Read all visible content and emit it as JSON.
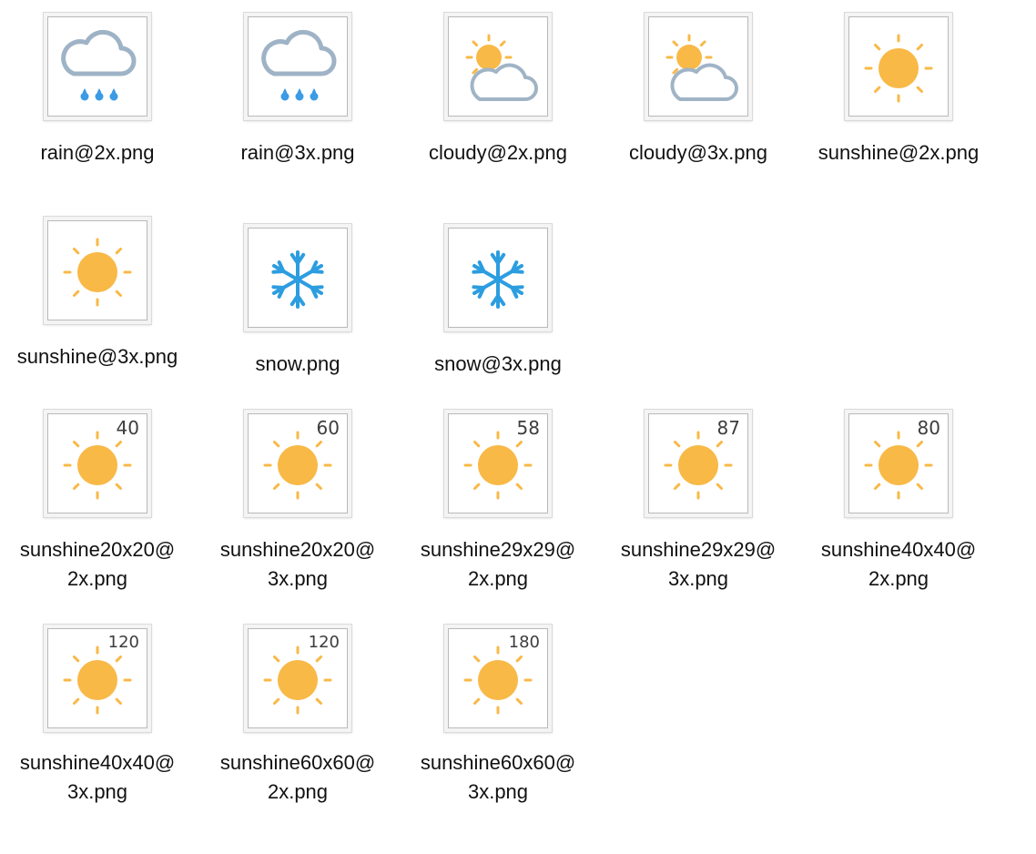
{
  "colors": {
    "rain_cloud": "#9fb3c6",
    "rain_drops": "#3b9be5",
    "cloud_outline": "#a0b4c6",
    "sun": "#f8b947",
    "snow": "#2c9de0"
  },
  "files": [
    {
      "name": "rain@2x.png",
      "icon": "rain-icon",
      "label_lines": [
        "rain@2x.png"
      ]
    },
    {
      "name": "rain@3x.png",
      "icon": "rain-icon",
      "label_lines": [
        "rain@3x.png"
      ]
    },
    {
      "name": "cloudy@2x.png",
      "icon": "cloudy-icon",
      "label_lines": [
        "cloudy@2x.png"
      ]
    },
    {
      "name": "cloudy@3x.png",
      "icon": "cloudy-icon",
      "label_lines": [
        "cloudy@3x.png"
      ]
    },
    {
      "name": "sunshine@2x.png",
      "icon": "sun-icon",
      "label_lines": [
        "sunshine@2x.png"
      ]
    },
    {
      "name": "sunshine@3x.png",
      "icon": "sun-icon",
      "label_lines": [
        "sunshine@3x.png"
      ]
    },
    {
      "name": "snow.png",
      "icon": "snowflake-icon",
      "label_lines": [
        "snow.png"
      ]
    },
    {
      "name": "snow@3x.png",
      "icon": "snowflake-icon",
      "label_lines": [
        "snow@3x.png"
      ]
    },
    {
      "name": "sunshine20x20@2x.png",
      "icon": "sun-icon",
      "badge": "40",
      "label_lines": [
        "sunshine20x20@",
        "2x.png"
      ]
    },
    {
      "name": "sunshine20x20@3x.png",
      "icon": "sun-icon",
      "badge": "60",
      "label_lines": [
        "sunshine20x20@",
        "3x.png"
      ]
    },
    {
      "name": "sunshine29x29@2x.png",
      "icon": "sun-icon",
      "badge": "58",
      "label_lines": [
        "sunshine29x29@",
        "2x.png"
      ]
    },
    {
      "name": "sunshine29x29@3x.png",
      "icon": "sun-icon",
      "badge": "87",
      "label_lines": [
        "sunshine29x29@",
        "3x.png"
      ]
    },
    {
      "name": "sunshine40x40@2x.png",
      "icon": "sun-icon",
      "badge": "80",
      "label_lines": [
        "sunshine40x40@",
        "2x.png"
      ]
    },
    {
      "name": "sunshine40x40@3x.png",
      "icon": "sun-icon",
      "badge": "120",
      "label_lines": [
        "sunshine40x40@",
        "3x.png"
      ]
    },
    {
      "name": "sunshine60x60@2x.png",
      "icon": "sun-icon",
      "badge": "120",
      "label_lines": [
        "sunshine60x60@",
        "2x.png"
      ]
    },
    {
      "name": "sunshine60x60@3x.png",
      "icon": "sun-icon",
      "badge": "180",
      "label_lines": [
        "sunshine60x60@",
        "3x.png"
      ]
    }
  ]
}
